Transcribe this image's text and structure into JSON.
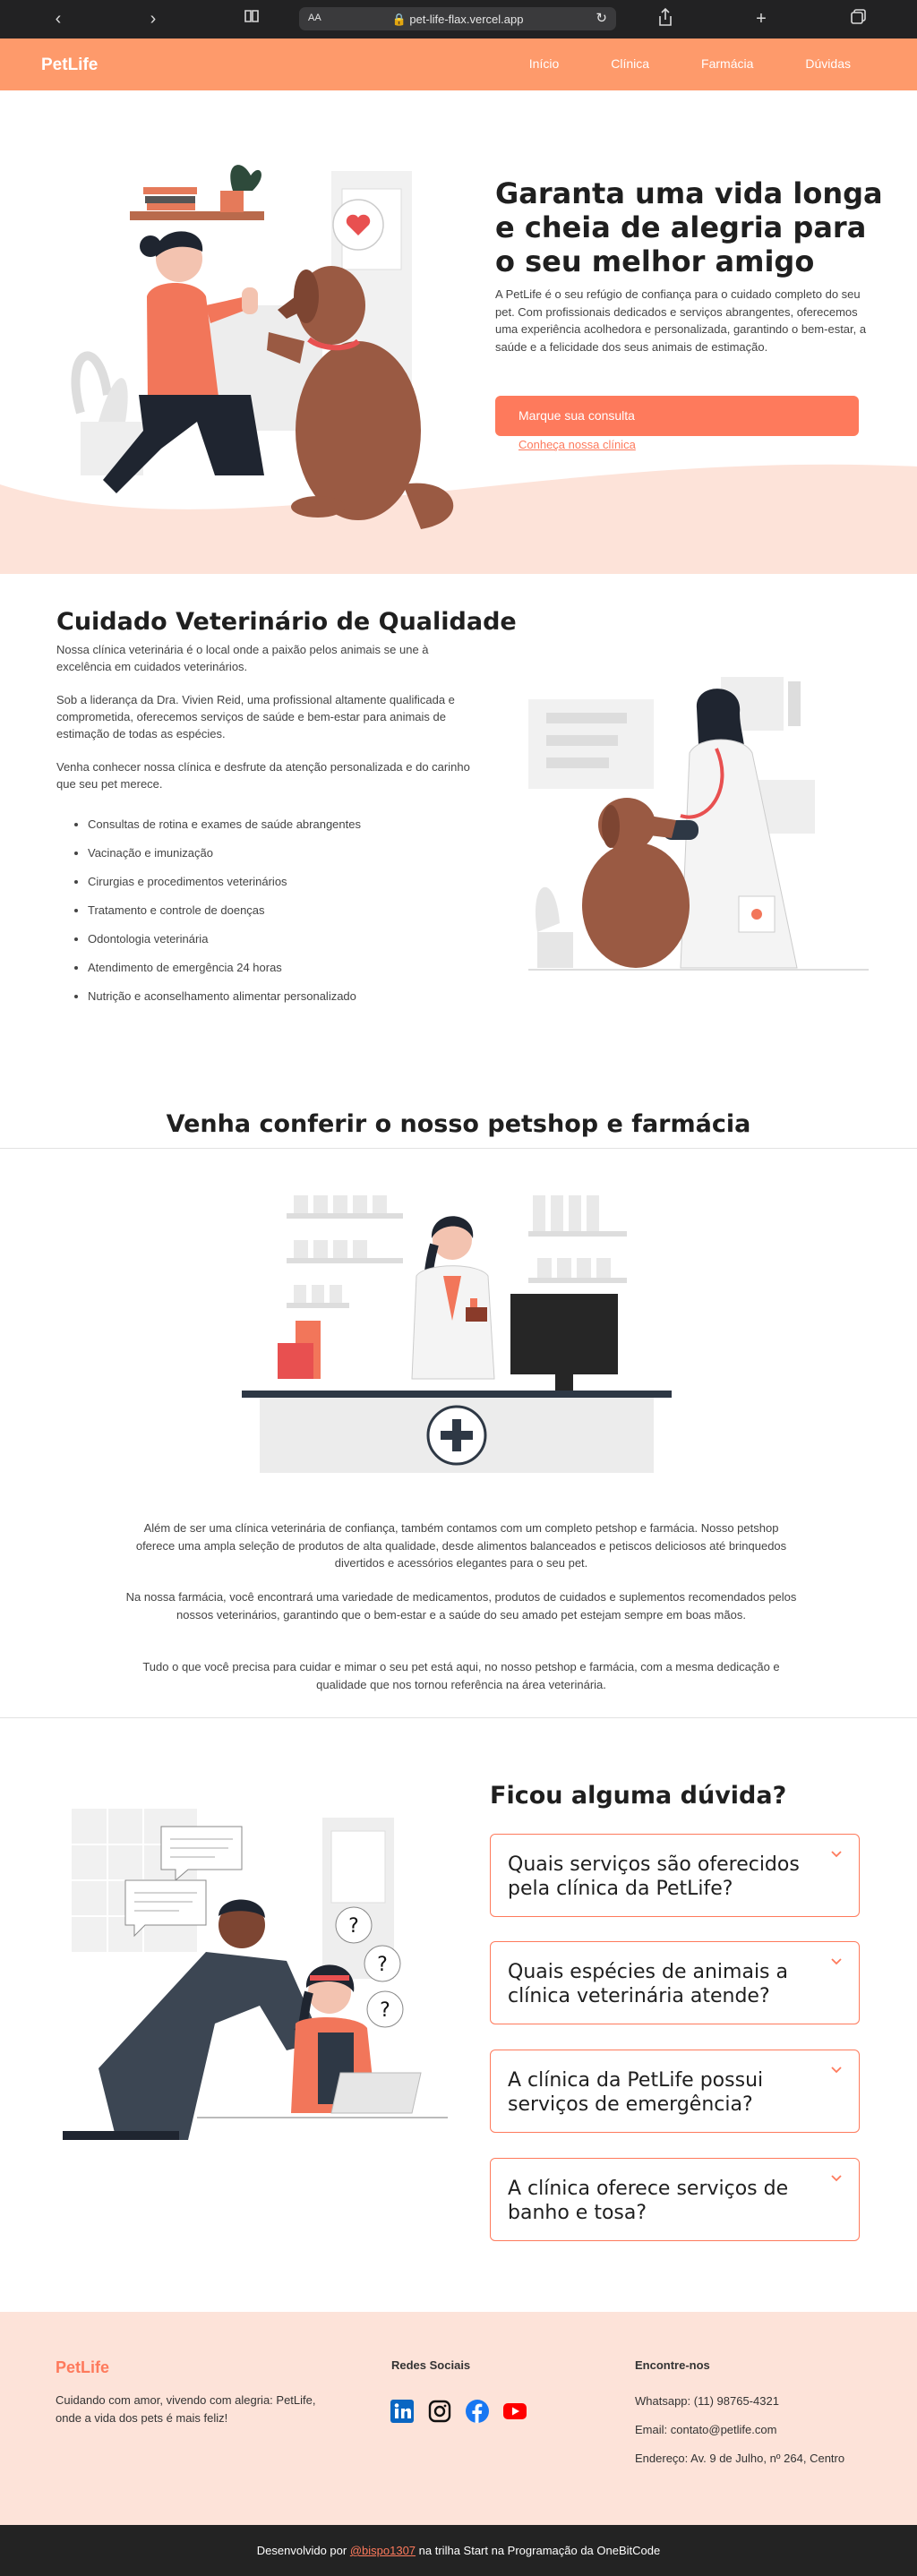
{
  "browser": {
    "text_size_label": "AA",
    "url": "pet-life-flax.vercel.app"
  },
  "nav": {
    "logo": "PetLife",
    "links": [
      "Início",
      "Clínica",
      "Farmácia",
      "Dúvidas"
    ]
  },
  "hero": {
    "title": "Garanta uma vida longa e cheia de alegria para o seu melhor amigo",
    "text": "A PetLife é o seu refúgio de confiança para o cuidado completo do seu pet. Com profissionais dedicados e serviços abrangentes, oferecemos uma experiência acolhedora e personalizada, garantindo o bem-estar, a saúde e a felicidade dos seus animais de estimação.",
    "primary_button": "Marque sua consulta",
    "secondary_link": "Conheça nossa clínica"
  },
  "clinic": {
    "title": "Cuidado Veterinário de Qualidade",
    "paragraphs": [
      "Nossa clínica veterinária é o local onde a paixão pelos animais se une à excelência em cuidados veterinários.",
      "Sob a liderança da Dra. Vivien Reid, uma profissional altamente qualificada e comprometida, oferecemos serviços de saúde e bem-estar para animais de estimação de todas as espécies.",
      "Venha conhecer nossa clínica e desfrute da atenção personalizada e do carinho que seu pet merece."
    ],
    "services": [
      "Consultas de rotina e exames de saúde abrangentes",
      "Vacinação e imunização",
      "Cirurgias e procedimentos veterinários",
      "Tratamento e controle de doenças",
      "Odontologia veterinária",
      "Atendimento de emergência 24 horas",
      "Nutrição e aconselhamento alimentar personalizado"
    ]
  },
  "petshop": {
    "title": "Venha conferir o nosso petshop e farmácia",
    "paragraphs": [
      "Além de ser uma clínica veterinária de confiança, também contamos com um completo petshop e farmácia. Nosso petshop oferece uma ampla seleção de produtos de alta qualidade, desde alimentos balanceados e petiscos deliciosos até brinquedos divertidos e acessórios elegantes para o seu pet.",
      "Na nossa farmácia, você encontrará uma variedade de medicamentos, produtos de cuidados e suplementos recomendados pelos nossos veterinários, garantindo que o bem-estar e a saúde do seu amado pet estejam sempre em boas mãos.",
      "Tudo o que você precisa para cuidar e mimar o seu pet está aqui, no nosso petshop e farmácia, com a mesma dedicação e qualidade que nos tornou referência na área veterinária."
    ]
  },
  "faq": {
    "title": "Ficou alguma dúvida?",
    "questions": [
      "Quais serviços são oferecidos pela clínica da PetLife?",
      "Quais espécies de animais a clínica veterinária atende?",
      "A clínica da PetLife possui serviços de emergência?",
      "A clínica oferece serviços de banho e tosa?"
    ],
    "bubble_marks": [
      "?",
      "?",
      "?"
    ]
  },
  "footer": {
    "logo": "PetLife",
    "tagline": "Cuidando com amor, vivendo com alegria: PetLife, onde a vida dos pets é mais feliz!",
    "social_heading": "Redes Sociais",
    "social_icons": [
      "linkedin-icon",
      "instagram-icon",
      "facebook-icon",
      "youtube-icon"
    ],
    "contact_heading": "Encontre-nos",
    "whatsapp": "Whatsapp: (11) 98765-4321",
    "email": "Email: contato@petlife.com",
    "address": "Endereço: Av. 9 de Julho, nº 264, Centro",
    "credit_prefix": "Desenvolvido por",
    "credit_handle": "@bispo1307",
    "credit_suffix": "na trilha Start na Programação da OneBitCode"
  },
  "colors": {
    "brand": "#fe9a6b",
    "accent": "#fe7a5c",
    "footer_bg": "#fde3d9",
    "bottom_bar": "#232323"
  }
}
